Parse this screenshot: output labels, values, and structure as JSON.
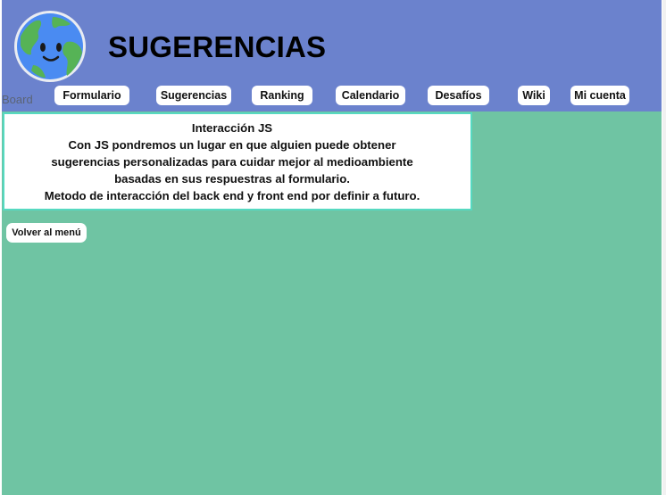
{
  "header": {
    "title": "SUGERENCIAS",
    "board_label": "Board",
    "logo_icon": "earth-icon"
  },
  "nav": {
    "items": [
      {
        "label": "Formulario"
      },
      {
        "label": "Sugerencias"
      },
      {
        "label": "Ranking"
      },
      {
        "label": "Calendario"
      },
      {
        "label": "Desafíos"
      },
      {
        "label": "Wiki"
      },
      {
        "label": "Mi cuenta"
      }
    ]
  },
  "info": {
    "heading": "Interacción JS",
    "lines": [
      "Con JS pondremos un lugar en que alguien puede obtener",
      "sugerencias personalizadas para cuidar mejor al medioambiente",
      "basadas en sus respuestras al formulario.",
      "Metodo de interacción del back end y front end por definir a futuro."
    ]
  },
  "back_button": {
    "label": "Volver al menú"
  },
  "colors": {
    "header_bg": "#6b82cd",
    "page_bg": "#6fc4a3",
    "box_border": "#56d9c1",
    "button_bg": "#ffffff"
  }
}
